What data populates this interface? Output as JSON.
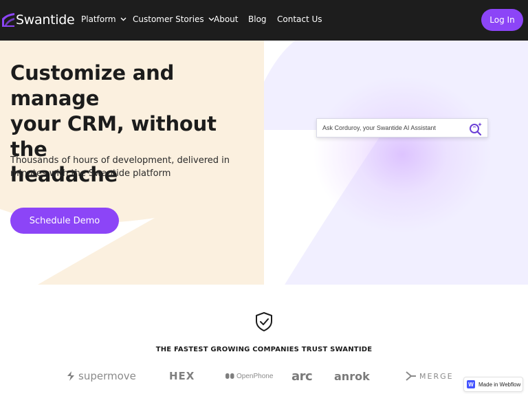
{
  "brand": {
    "name": "Swantide",
    "accent": "#8c45f7"
  },
  "nav": {
    "items": [
      {
        "label": "Platform",
        "has_dropdown": true
      },
      {
        "label": "Customer Stories",
        "has_dropdown": true
      },
      {
        "label": "About",
        "has_dropdown": false
      },
      {
        "label": "Blog",
        "has_dropdown": false
      },
      {
        "label": "Contact Us",
        "has_dropdown": false
      }
    ],
    "login_label": "Log In"
  },
  "hero": {
    "headline_lines": [
      "Customize and manage",
      "your CRM, without the",
      "headache"
    ],
    "subhead_lines": [
      "Thousands of hours of development, delivered in",
      "minutes with the Swantide platform"
    ],
    "cta_label": "Schedule Demo",
    "ai_search": {
      "placeholder": "Ask Corduroy, your Swantide AI Assistant",
      "icon": "sparkle-search-icon"
    }
  },
  "trust": {
    "icon": "shield-check-icon",
    "title": "THE FASTEST GROWING COMPANIES TRUST SWANTIDE",
    "logos": [
      "supermove",
      "HEX",
      "OpenPhone",
      "arc",
      "anrok",
      "MERGE"
    ]
  },
  "badge": {
    "label": "Made in Webflow",
    "mark": "W"
  },
  "colors": {
    "nav_bg": "#1d1d1d",
    "hero_left_shape": "#fbf0df",
    "hero_right_shape": "#f1efff"
  }
}
